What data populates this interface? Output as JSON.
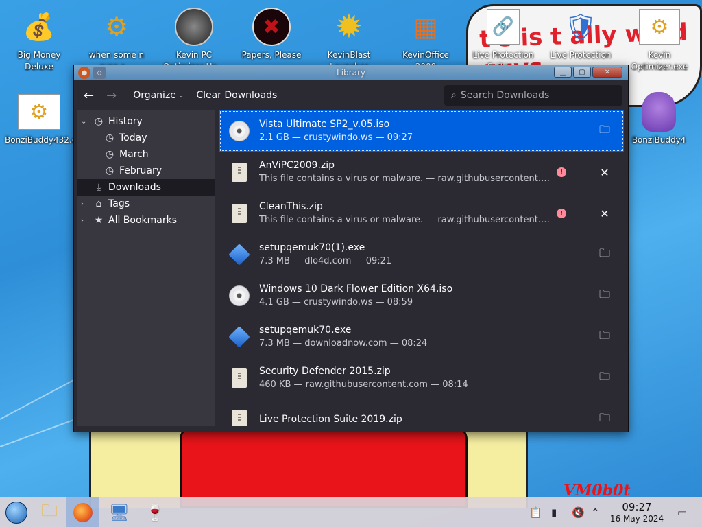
{
  "wallpaper": {
    "cloud_text": "t s is t ally wind  guys",
    "signature": "VM0b0t"
  },
  "desktop_icons": [
    {
      "label": "Big Money Deluxe",
      "icon": "money-bag-icon",
      "glyph": "💰"
    },
    {
      "label": "when some n runs a...",
      "icon": "gear-icon",
      "glyph": "⚙"
    },
    {
      "label": "Kevin PC Optimizer Ho...",
      "icon": "gauge-icon",
      "glyph": "⏱"
    },
    {
      "label": "Papers, Please",
      "icon": "papers-please-icon",
      "glyph": "✖"
    },
    {
      "label": "KevinBlast Launcher",
      "icon": "starburst-icon",
      "glyph": "✹"
    },
    {
      "label": "KevinOffice 2009",
      "icon": "office-icon",
      "glyph": "▦"
    },
    {
      "label": "Live Protection Suite ...",
      "icon": "shortcut-icon",
      "glyph": "🔗"
    },
    {
      "label": "Live Protection ...",
      "icon": "shield-icon",
      "glyph": "🛡"
    },
    {
      "label": "Kevin Optimizer.exe",
      "icon": "gear-icon",
      "glyph": "⚙"
    },
    {
      "label": "BonziBuddy432.exe",
      "icon": "gear-icon",
      "glyph": "⚙"
    },
    {
      "label": "BonziBuddy4",
      "icon": "purple-gorilla-icon",
      "glyph": "🦍"
    }
  ],
  "window": {
    "title": "Library",
    "toolbar": {
      "organize": "Organize",
      "clear": "Clear Downloads",
      "search_placeholder": "Search Downloads"
    },
    "sidebar": {
      "history": "History",
      "today": "Today",
      "march": "March",
      "february": "February",
      "downloads": "Downloads",
      "tags": "Tags",
      "bookmarks": "All Bookmarks"
    },
    "downloads": [
      {
        "name": "Vista Ultimate SP2_v.05.iso",
        "meta": "2.1 GB — crustywindo.ws — 09:27",
        "type": "disc",
        "action": "folder",
        "selected": true
      },
      {
        "name": "AnViPC2009.zip",
        "meta": "This file contains a virus or malware. — raw.githubusercontent.co...",
        "type": "zip",
        "action": "remove",
        "warning": true
      },
      {
        "name": "CleanThis.zip",
        "meta": "This file contains a virus or malware. — raw.githubusercontent.co...",
        "type": "zip",
        "action": "remove",
        "warning": true
      },
      {
        "name": "setupqemuk70(1).exe",
        "meta": "7.3 MB — dlo4d.com — 09:21",
        "type": "exe",
        "action": "folder"
      },
      {
        "name": "Windows 10 Dark Flower Edition X64.iso",
        "meta": "4.1 GB — crustywindo.ws — 08:59",
        "type": "disc",
        "action": "folder"
      },
      {
        "name": "setupqemuk70.exe",
        "meta": "7.3 MB — downloadnow.com — 08:24",
        "type": "exe",
        "action": "folder"
      },
      {
        "name": "Security Defender 2015.zip",
        "meta": "460 KB — raw.githubusercontent.com — 08:14",
        "type": "zip",
        "action": "folder"
      },
      {
        "name": "Live Protection Suite 2019.zip",
        "meta": "",
        "type": "zip",
        "action": "folder"
      }
    ]
  },
  "taskbar": {
    "clock_time": "09:27",
    "clock_date": "16 May 2024"
  },
  "colors": {
    "selection": "#0061e0",
    "window_bg": "#2b2a33",
    "sidebar_bg": "#38373f",
    "warning": "#ff8a9a"
  }
}
